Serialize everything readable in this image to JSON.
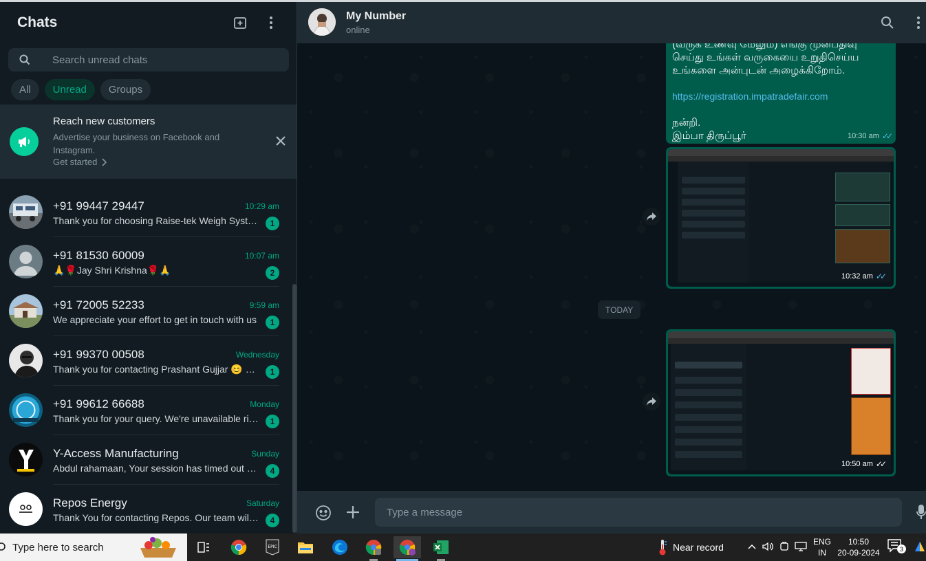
{
  "sidebar": {
    "title": "Chats",
    "search_placeholder": "Search unread chats",
    "filters": [
      "All",
      "Unread",
      "Groups"
    ],
    "promo": {
      "title": "Reach new customers",
      "description": "Advertise your business on Facebook and Instagram.",
      "cta": "Get started"
    },
    "chats": [
      {
        "name": "+91 99447 29447",
        "time": "10:29 am",
        "preview": "Thank you for choosing Raise-tek Weigh Systems",
        "unread": "1"
      },
      {
        "name": "+91 81530 60009",
        "time": "10:07 am",
        "preview": "🙏🌹Jay Shri Krishna🌹🙏",
        "unread": "2"
      },
      {
        "name": "+91 72005 52233",
        "time": "9:59 am",
        "preview": "We appreciate your effort to get in touch with us",
        "unread": "1"
      },
      {
        "name": "+91 99370 00508",
        "time": "Wednesday",
        "preview": "Thank you for contacting Prashant Gujjar 😊 Please",
        "unread": "1"
      },
      {
        "name": "+91 99612 66688",
        "time": "Monday",
        "preview": "Thank you for your query.  We're unavailable right now",
        "unread": "1"
      },
      {
        "name": "Y-Access Manufacturing",
        "time": "Sunday",
        "preview": "Abdul rahamaan, Your session has timed out due to",
        "unread": "4"
      },
      {
        "name": "Repos Energy",
        "time": "Saturday",
        "preview": "Thank You for contacting Repos.  Our team will get back",
        "unread": "4"
      }
    ]
  },
  "conversation": {
    "name": "My Number",
    "status": "online",
    "messages": {
      "text_lines": [
        "(வருக உணவு மேலும்) எங்கு முன்பதிவு",
        "செய்து உங்கள் வருகையை உறுதிசெய்ய",
        "உங்களை அன்புடன் அழைக்கிறோம்."
      ],
      "link": "https://registration.impatradefair.com",
      "closing": [
        "நன்றி.",
        "இம்பா திருப்பூர்"
      ],
      "text_time": "10:30 am",
      "image1_time": "10:32 am",
      "date_divider": "TODAY",
      "image2_time": "10:50 am"
    },
    "composer_placeholder": "Type a message"
  },
  "taskbar": {
    "search_placeholder": "Type here to search",
    "weather": "Near record",
    "lang_top": "ENG",
    "lang_bottom": "IN",
    "time": "10:50",
    "date": "20-09-2024",
    "notification_count": "3"
  },
  "colors": {
    "accent": "#00a884",
    "bubble_out": "#005c4b",
    "panel": "#202c33",
    "background": "#111b21"
  }
}
